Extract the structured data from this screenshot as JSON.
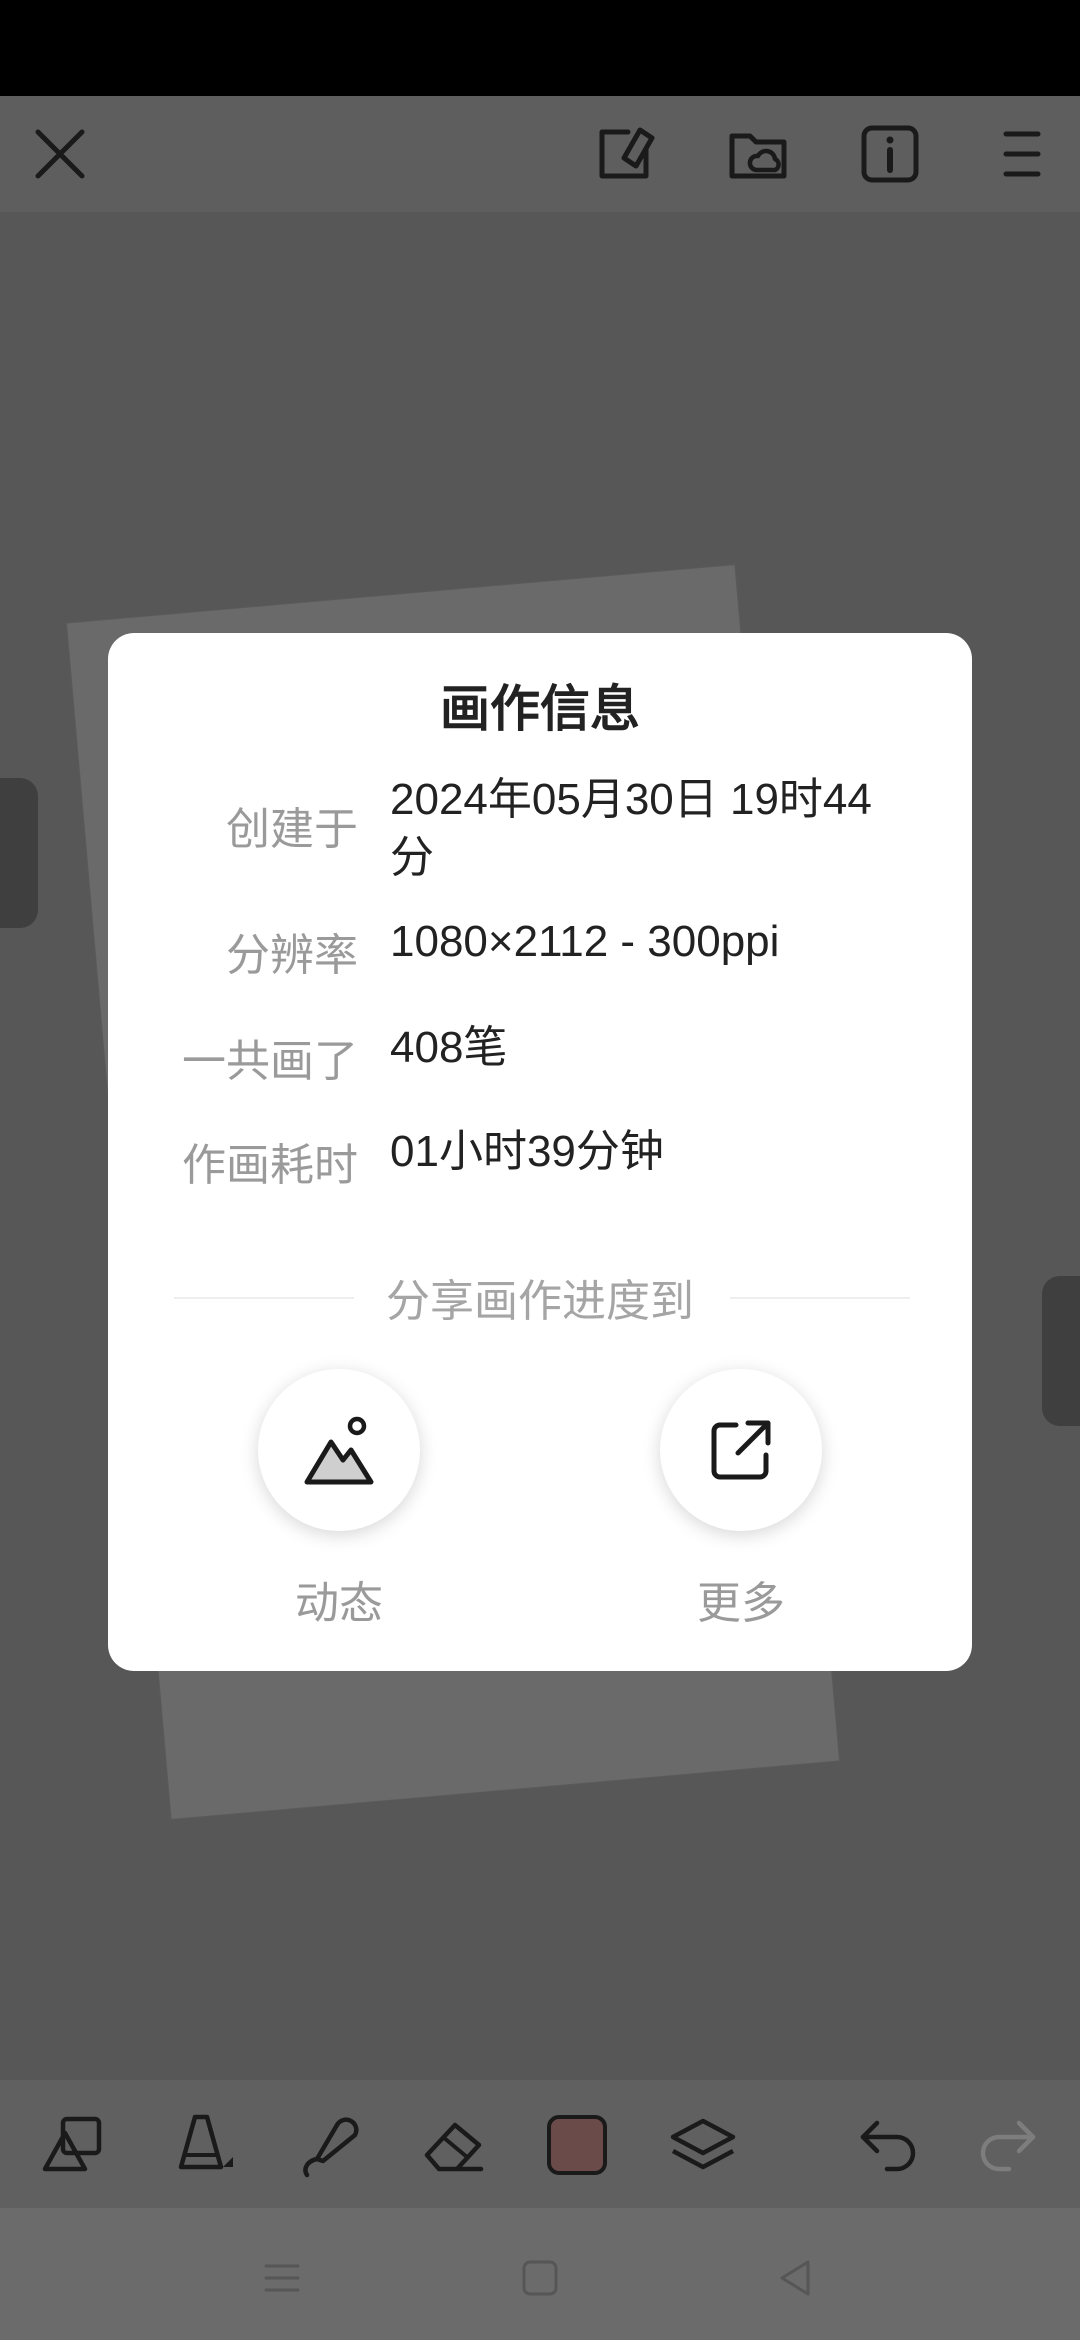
{
  "icons": {
    "close": "close-icon",
    "sticker": "sticker-icon",
    "folder_cloud": "folder-cloud-icon",
    "info": "info-icon",
    "menu": "menu-icon",
    "shapes": "shapes-icon",
    "brush": "brush-icon",
    "smudge": "smudge-icon",
    "eraser": "eraser-icon",
    "layers": "layers-icon",
    "undo": "undo-icon",
    "redo": "redo-icon"
  },
  "dialog": {
    "title": "画作信息",
    "rows": [
      {
        "label": "创建于",
        "value": "2024年05月30日 19时44分"
      },
      {
        "label": "分辨率",
        "value": "1080×2112 - 300ppi"
      },
      {
        "label": "一共画了",
        "value": "408笔"
      },
      {
        "label": "作画耗时",
        "value": "01小时39分钟"
      }
    ],
    "share_title": "分享画作进度到",
    "share_buttons": [
      {
        "label": "动态",
        "icon": "mountain-image-icon"
      },
      {
        "label": "更多",
        "icon": "external-share-icon"
      }
    ]
  },
  "toolbar": {
    "current_color": "#6b4a4a"
  },
  "colors": {
    "dim_background": "#5b5b5b",
    "dialog_background": "#ffffff",
    "status_bar": "#000000"
  }
}
